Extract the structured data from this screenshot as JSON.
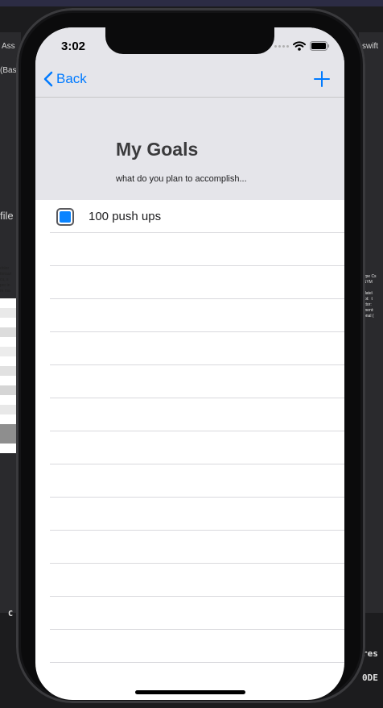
{
  "background": {
    "left_labels": [
      "Ass",
      "(Bas",
      "file"
    ],
    "right_labels": [
      "swift"
    ],
    "left_code_snippet": "dolor\nttetaur\ncu, s\npor in\nre ma",
    "right_code_snippet": "ype Cs\nSYM\n\ndate\\\nlot:  t\nctor:\nment:\nonal (",
    "bottom_left_text": "C",
    "bottom_right_text_1": "res",
    "bottom_right_text_2": "0DE"
  },
  "status_bar": {
    "time": "3:02",
    "icons": [
      "cellular-signal-icon",
      "wifi-icon",
      "battery-icon"
    ]
  },
  "nav_bar": {
    "back_label": "Back",
    "back_icon": "chevron-left-icon",
    "add_icon": "plus-icon"
  },
  "header": {
    "title": "My Goals",
    "subtitle": "what do you plan to accomplish..."
  },
  "goals": [
    {
      "label": "100 push ups",
      "checked": true
    }
  ],
  "empty_row_count": 13,
  "colors": {
    "accent": "#007aff",
    "checkbox_fill": "#0a84ff",
    "header_background": "#e5e5ea"
  }
}
